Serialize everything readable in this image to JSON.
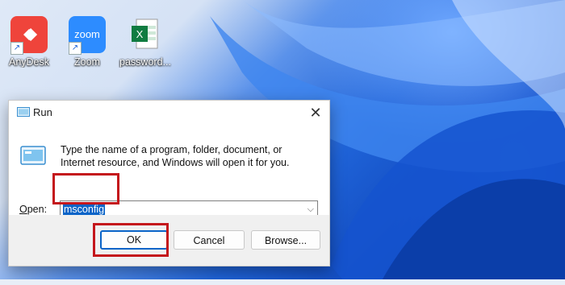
{
  "desktop": {
    "icons": [
      {
        "label": "AnyDesk",
        "icon": "anydesk-icon",
        "color": "#ef443b"
      },
      {
        "label": "Zoom",
        "icon": "zoom-icon",
        "color": "#2d8cff",
        "glyph_text": "zoom"
      },
      {
        "label": "password...",
        "icon": "excel-file-icon",
        "color": "#107c41"
      }
    ]
  },
  "run_dialog": {
    "title": "Run",
    "description": "Type the name of a program, folder, document, or Internet resource, and Windows will open it for you.",
    "open_label_prefix": "",
    "open_label_accel": "O",
    "open_label_rest": "pen:",
    "input_value": "msconfig",
    "buttons": {
      "ok": "OK",
      "cancel": "Cancel",
      "browse": "Browse..."
    },
    "accent_color": "#0a64c8",
    "highlight_color": "#c4161c"
  }
}
